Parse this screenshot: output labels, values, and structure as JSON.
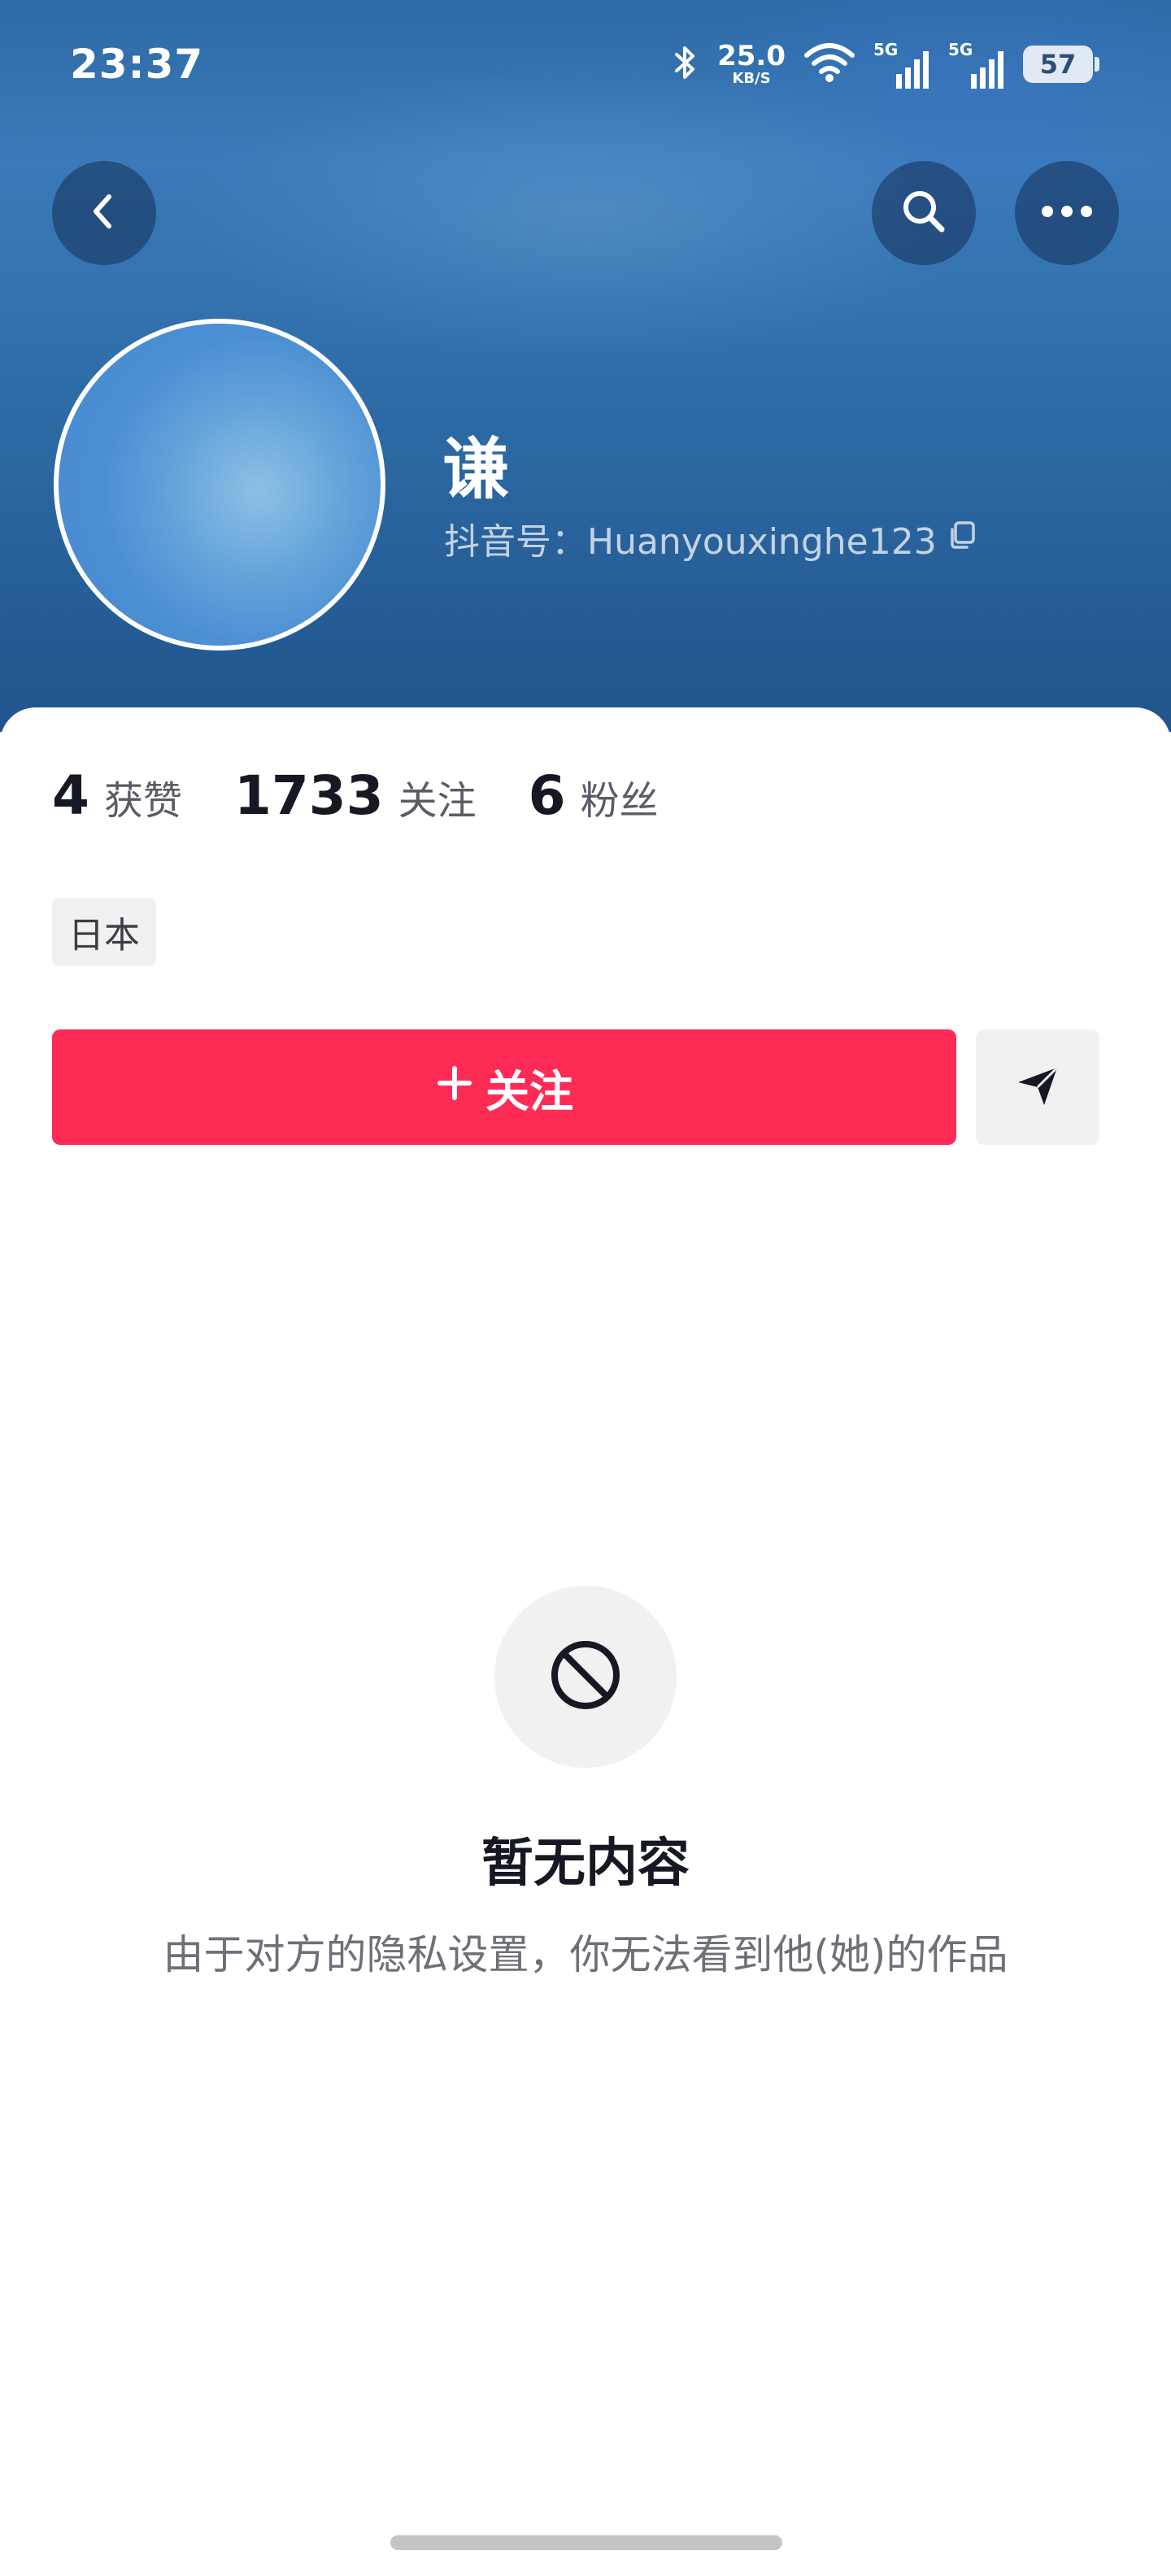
{
  "status_bar": {
    "time": "23:37",
    "net_speed_value": "25.0",
    "net_speed_unit": "KB/S",
    "signal1_label": "5G",
    "signal2_label": "5G",
    "battery": "57",
    "icons": [
      "bluetooth-icon",
      "wifi-icon",
      "signal-icon",
      "signal-icon",
      "battery-icon"
    ]
  },
  "header": {
    "back_icon": "chevron-left-icon",
    "search_icon": "search-icon",
    "more_icon": "ellipsis-icon"
  },
  "profile": {
    "name": "谦",
    "id_label": "抖音号：Huanyouxinghe123"
  },
  "stats": [
    {
      "value": "4",
      "label": "获赞"
    },
    {
      "value": "1733",
      "label": "关注"
    },
    {
      "value": "6",
      "label": "粉丝"
    }
  ],
  "tag": "日本",
  "actions": {
    "follow_label": "关注",
    "follow_color": "#fe2c55",
    "share_icon": "send-icon"
  },
  "empty_state": {
    "icon": "block-icon",
    "title": "暂无内容",
    "description": "由于对方的隐私设置，你无法看到他(她)的作品"
  }
}
